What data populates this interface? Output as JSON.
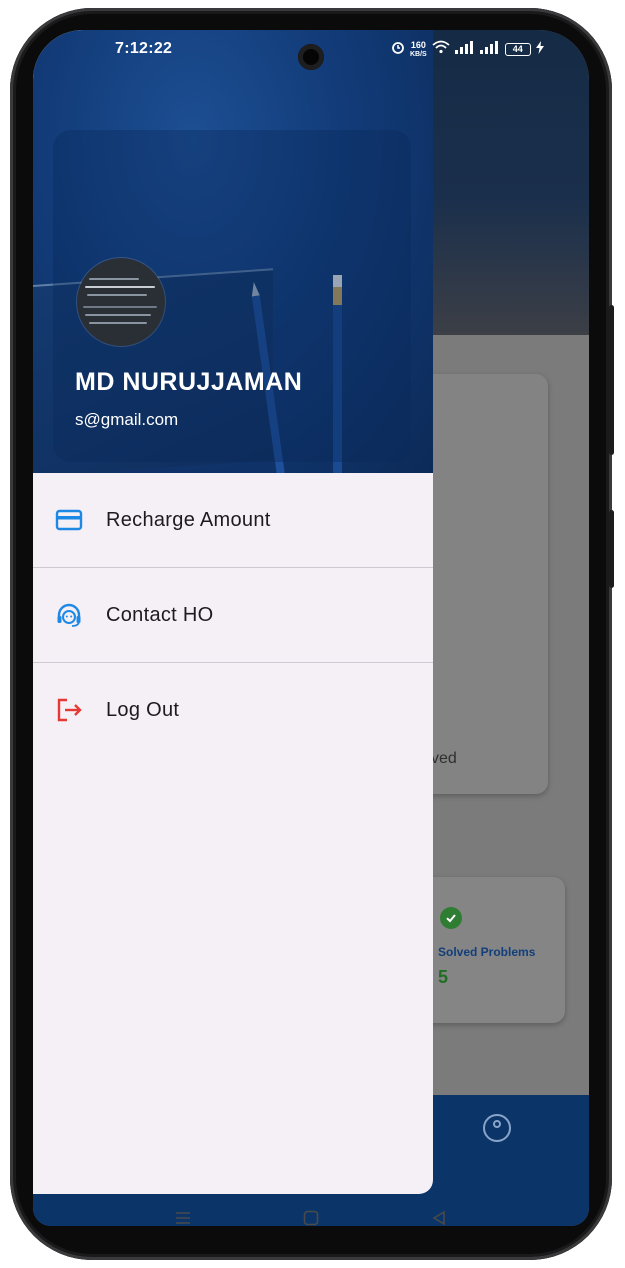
{
  "status_bar": {
    "time": "7:12:22",
    "network_speed_top": "160",
    "network_speed_unit": "KB/S",
    "battery_level": "44"
  },
  "drawer": {
    "user_name": "MD NURUJJAMAN",
    "user_email": "s@gmail.com",
    "menu_items": [
      {
        "label": "Recharge Amount",
        "icon": "credit-card-icon",
        "icon_color": "#1e88e5"
      },
      {
        "label": "Contact HO",
        "icon": "support-agent-icon",
        "icon_color": "#1e88e5"
      },
      {
        "label": "Log Out",
        "icon": "logout-icon",
        "icon_color": "#e53935"
      }
    ]
  },
  "background_app": {
    "card_partial_text": "ved",
    "solved_problems_label": "Solved Problems",
    "solved_problems_value": "5"
  },
  "colors": {
    "drawer_background": "#f5eff6",
    "header_blue": "#123b78",
    "bottom_nav": "#0b3468"
  }
}
